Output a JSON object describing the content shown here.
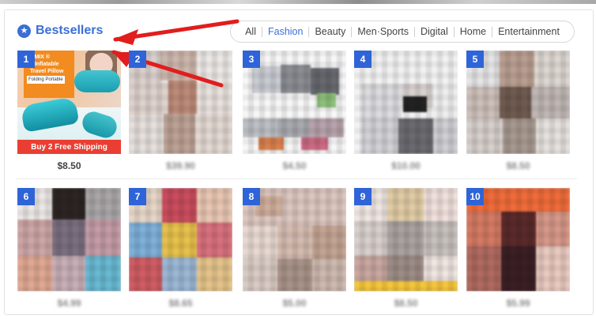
{
  "title": "Bestsellers",
  "tabs": [
    "All",
    "Fashion",
    "Beauty",
    "Men·Sports",
    "Digital",
    "Home",
    "Entertainment"
  ],
  "active_tab": "Fashion",
  "products": [
    {
      "rank": "1",
      "price": "$8.50",
      "image_text": {
        "brand": "OMIX ®",
        "line1": "s Inflatable",
        "line2": "Travel Pillow",
        "line3": "Folding Portable",
        "promo": "Buy 2 Free Shipping"
      }
    },
    {
      "rank": "2",
      "price": "$39.90"
    },
    {
      "rank": "3",
      "price": "$4.50"
    },
    {
      "rank": "4",
      "price": "$10.00"
    },
    {
      "rank": "5",
      "price": "$8.50"
    },
    {
      "rank": "6",
      "price": "$4.99"
    },
    {
      "rank": "7",
      "price": "$8.65"
    },
    {
      "rank": "8",
      "price": "$5.00"
    },
    {
      "rank": "9",
      "price": "$8.50"
    },
    {
      "rank": "10",
      "price": "$5.99"
    }
  ],
  "colors": {
    "accent": "#3a6fd6",
    "rank_badge": "#2f64d8",
    "arrow": "#e11d1d",
    "promo_bar": "#ea3e32"
  },
  "icons": {
    "title_icon": "star-icon"
  }
}
